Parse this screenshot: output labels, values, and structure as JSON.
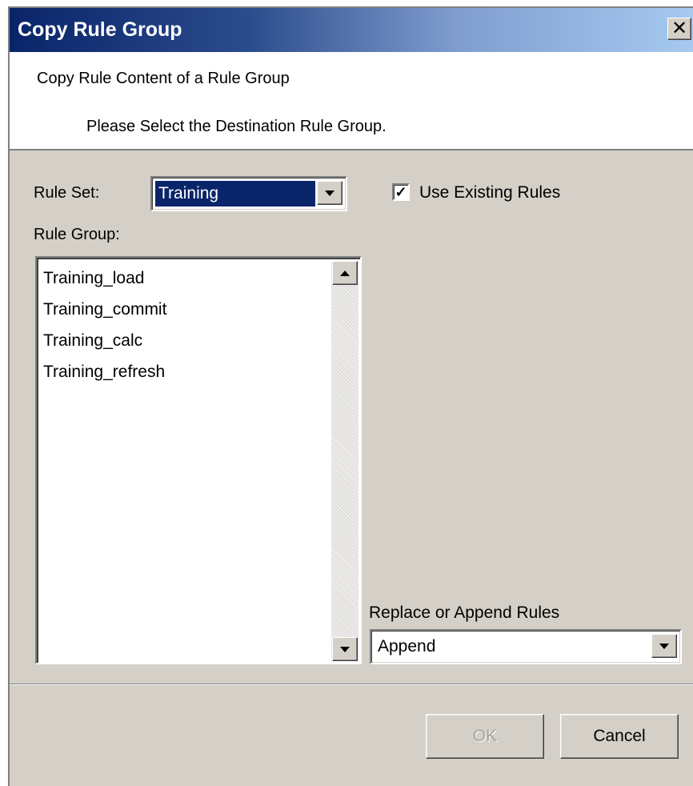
{
  "window": {
    "title": "Copy Rule Group",
    "close_glyph": "✕"
  },
  "header": {
    "title": "Copy Rule Content of a Rule Group",
    "subtitle": "Please Select the Destination Rule Group."
  },
  "rule_set": {
    "label": "Rule Set:",
    "value": "Training"
  },
  "use_existing": {
    "label": "Use Existing Rules",
    "checked": true,
    "check_glyph": "✓"
  },
  "rule_group": {
    "label": "Rule Group:",
    "items": [
      "Training_load",
      "Training_commit",
      "Training_calc",
      "Training_refresh"
    ]
  },
  "replace_append": {
    "label": "Replace or Append Rules",
    "value": "Append"
  },
  "buttons": {
    "ok": "OK",
    "cancel": "Cancel"
  },
  "colors": {
    "titlebar_start": "#0a246a",
    "titlebar_end": "#a6caf0",
    "dialog_bg": "#d4d0c8",
    "selection": "#0a246a"
  }
}
